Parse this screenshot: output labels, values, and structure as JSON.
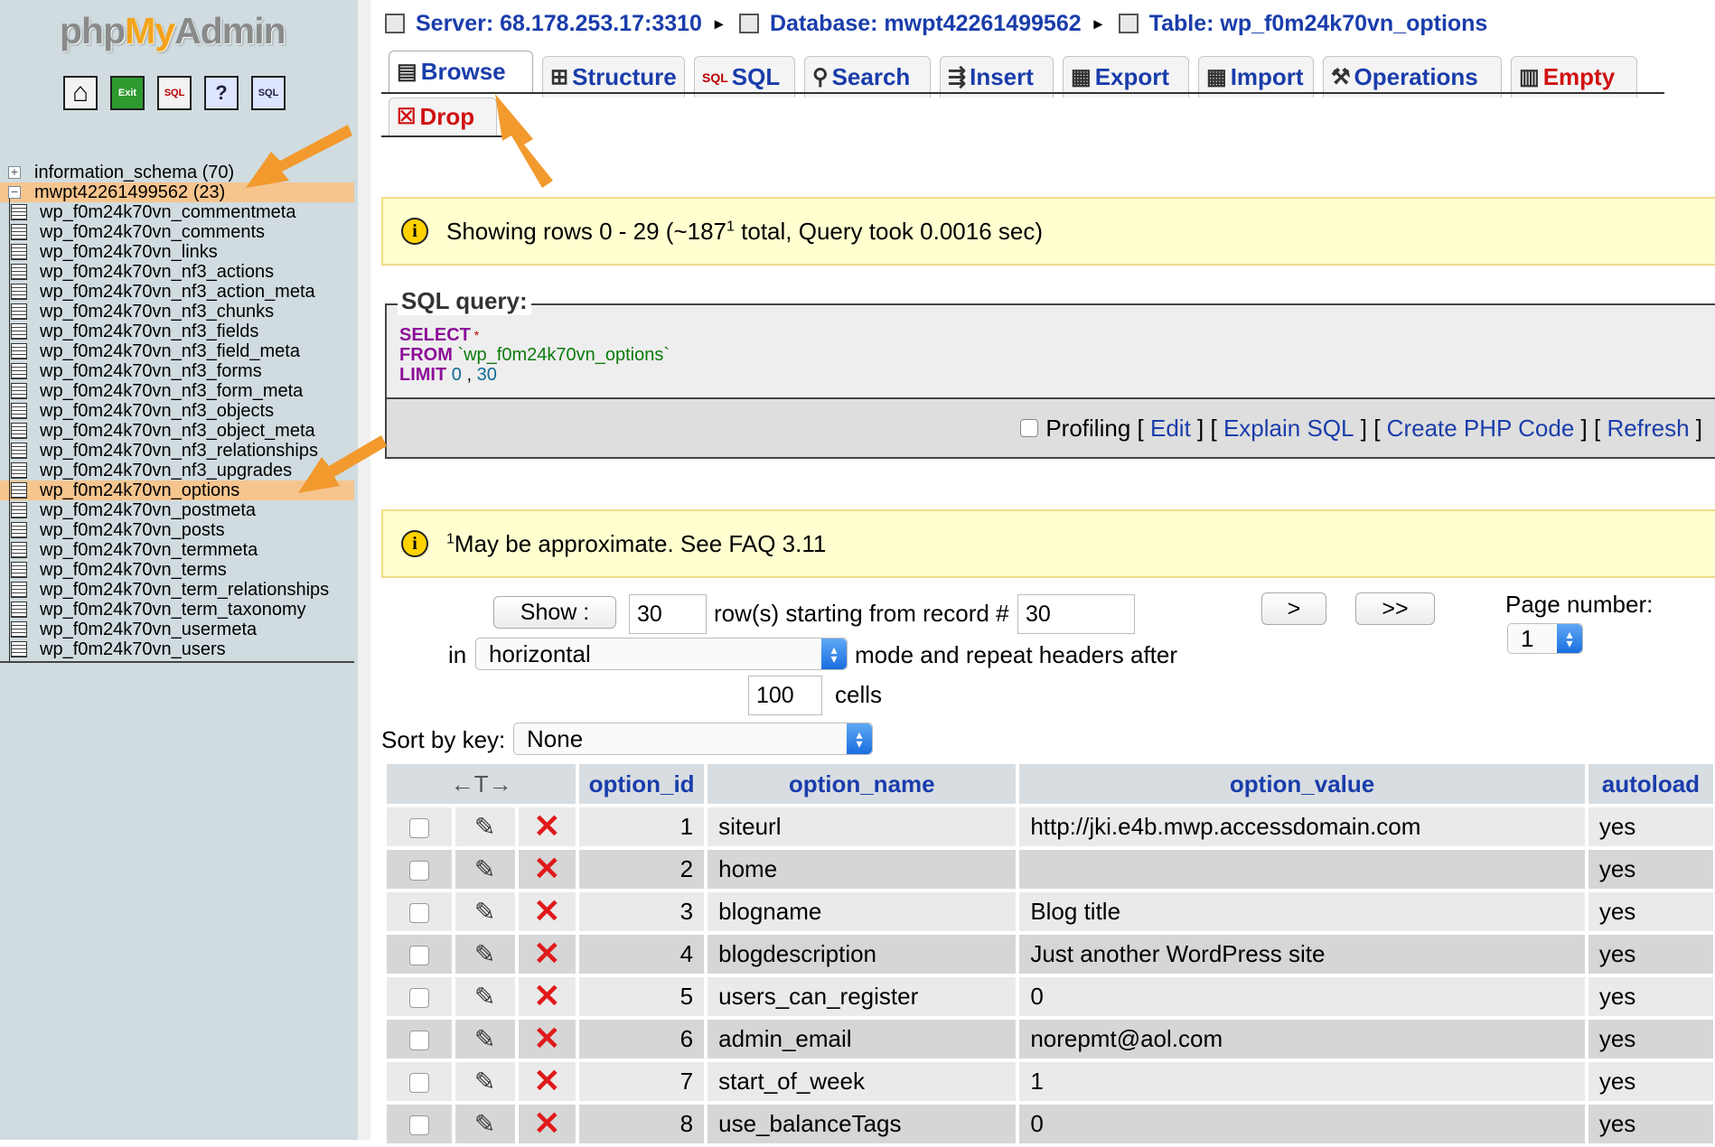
{
  "logo": {
    "part1": "php",
    "part2": "My",
    "part3": "Admin"
  },
  "quicknav": [
    {
      "name": "home-icon",
      "glyph": "⌂"
    },
    {
      "name": "exit-icon",
      "glyph": "Exit"
    },
    {
      "name": "sql-icon",
      "glyph": "SQL"
    },
    {
      "name": "help-icon",
      "glyph": "?"
    },
    {
      "name": "query-window-icon",
      "glyph": "SQL"
    }
  ],
  "tree": {
    "databases": [
      {
        "label": "information_schema (70)",
        "toggle": "+"
      },
      {
        "label": "mwpt42261499562 (23)",
        "toggle": "−"
      }
    ],
    "tables": [
      "wp_f0m24k70vn_commentmeta",
      "wp_f0m24k70vn_comments",
      "wp_f0m24k70vn_links",
      "wp_f0m24k70vn_nf3_actions",
      "wp_f0m24k70vn_nf3_action_meta",
      "wp_f0m24k70vn_nf3_chunks",
      "wp_f0m24k70vn_nf3_fields",
      "wp_f0m24k70vn_nf3_field_meta",
      "wp_f0m24k70vn_nf3_forms",
      "wp_f0m24k70vn_nf3_form_meta",
      "wp_f0m24k70vn_nf3_objects",
      "wp_f0m24k70vn_nf3_object_meta",
      "wp_f0m24k70vn_nf3_relationships",
      "wp_f0m24k70vn_nf3_upgrades",
      "wp_f0m24k70vn_options",
      "wp_f0m24k70vn_postmeta",
      "wp_f0m24k70vn_posts",
      "wp_f0m24k70vn_termmeta",
      "wp_f0m24k70vn_terms",
      "wp_f0m24k70vn_term_relationships",
      "wp_f0m24k70vn_term_taxonomy",
      "wp_f0m24k70vn_usermeta",
      "wp_f0m24k70vn_users"
    ],
    "selected_table": "wp_f0m24k70vn_options"
  },
  "breadcrumb": {
    "server": "Server: 68.178.253.17:3310",
    "database": "Database: mwpt42261499562",
    "table": "Table: wp_f0m24k70vn_options",
    "separator": "▸"
  },
  "tabs": [
    {
      "label": "Browse",
      "icon": "browse-icon"
    },
    {
      "label": "Structure",
      "icon": "structure-icon"
    },
    {
      "label": "SQL",
      "icon": "sql-icon"
    },
    {
      "label": "Search",
      "icon": "search-icon"
    },
    {
      "label": "Insert",
      "icon": "insert-icon"
    },
    {
      "label": "Export",
      "icon": "export-icon"
    },
    {
      "label": "Import",
      "icon": "import-icon"
    },
    {
      "label": "Operations",
      "icon": "operations-icon"
    },
    {
      "label": "Empty",
      "icon": "empty-icon"
    },
    {
      "label": "Drop",
      "icon": "drop-icon"
    }
  ],
  "notice1": {
    "pre": "Showing rows 0 - 29 (~187",
    "sup": "1",
    "post": " total, Query took 0.0016 sec)"
  },
  "sql": {
    "legend": "SQL query:",
    "select_kw": "SELECT",
    "select_rest": " *",
    "from_kw": "FROM",
    "from_rest": " `wp_f0m24k70vn_options`",
    "limit_kw": "LIMIT",
    "limit_a": " 0",
    "limit_sep": " , ",
    "limit_b": "30",
    "profiling": "Profiling",
    "bracket_open": "[",
    "bracket_close": "]",
    "edit": "Edit",
    "explain": "Explain SQL",
    "php": "Create PHP Code",
    "refresh": "Refresh"
  },
  "notice2": {
    "sup": "1",
    "text": "May be approximate. See FAQ 3.11"
  },
  "nav": {
    "show_button": "Show :",
    "rows_value": "30",
    "rows_label": "row(s) starting from record #",
    "start_value": "30",
    "next": ">",
    "last": ">>",
    "page_label": "Page number:",
    "page_value": "1",
    "in_label": "in",
    "mode_value": "horizontal",
    "mode_label": "mode and repeat headers after",
    "repeat_value": "100",
    "cells_label": "cells",
    "sort_label": "Sort by key:",
    "sort_value": "None"
  },
  "table": {
    "arrows_header": "←T→",
    "columns": [
      "option_id",
      "option_name",
      "option_value",
      "autoload"
    ],
    "rows": [
      {
        "id": "1",
        "name": "siteurl",
        "value": "http://jki.e4b.mwp.accessdomain.com",
        "autoload": "yes"
      },
      {
        "id": "2",
        "name": "home",
        "value": "",
        "autoload": "yes"
      },
      {
        "id": "3",
        "name": "blogname",
        "value": "Blog title",
        "autoload": "yes"
      },
      {
        "id": "4",
        "name": "blogdescription",
        "value": "Just another WordPress site",
        "autoload": "yes"
      },
      {
        "id": "5",
        "name": "users_can_register",
        "value": "0",
        "autoload": "yes"
      },
      {
        "id": "6",
        "name": "admin_email",
        "value": "norepmt@aol.com",
        "autoload": "yes"
      },
      {
        "id": "7",
        "name": "start_of_week",
        "value": "1",
        "autoload": "yes"
      },
      {
        "id": "8",
        "name": "use_balanceTags",
        "value": "0",
        "autoload": "yes"
      }
    ]
  },
  "colors": {
    "link": "#1a3dab",
    "highlight": "#f6c58e",
    "arrow": "#f29a2e",
    "danger": "#d01010"
  }
}
